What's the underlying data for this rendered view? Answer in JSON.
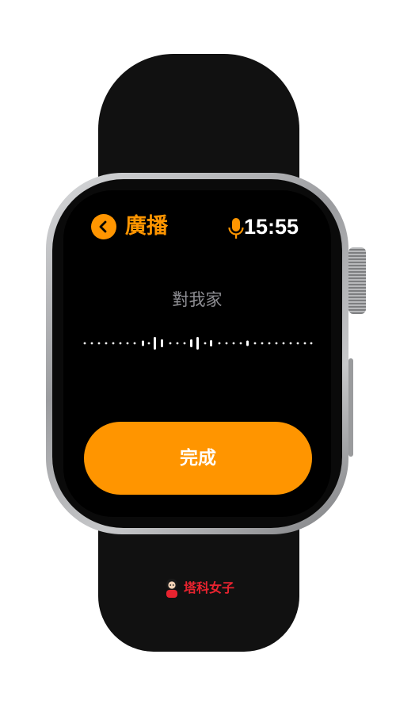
{
  "header": {
    "title": "廣播",
    "time": "15:55",
    "back_icon": "chevron-left-icon",
    "mic_icon": "microphone-icon"
  },
  "transcript": {
    "text": "對我家"
  },
  "actions": {
    "done_label": "完成"
  },
  "watermark": {
    "text": "塔科女子"
  },
  "colors": {
    "accent": "#ff9500",
    "screen": "#000000",
    "transcript": "#8e8e93",
    "watermark": "#e8232f"
  }
}
